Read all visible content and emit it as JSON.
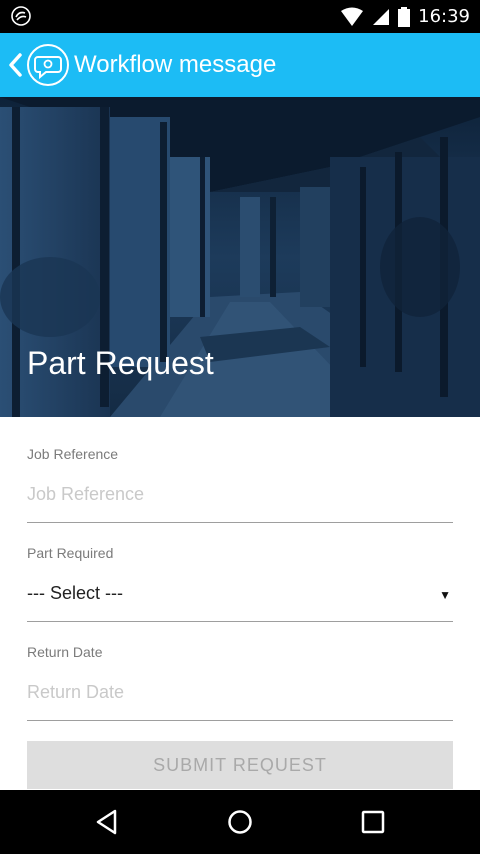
{
  "status_bar": {
    "time": "16:39"
  },
  "app_bar": {
    "title": "Workflow message"
  },
  "hero": {
    "title": "Part Request"
  },
  "form": {
    "job_reference": {
      "label": "Job Reference",
      "placeholder": "Job Reference"
    },
    "part_required": {
      "label": "Part Required",
      "value": "--- Select ---"
    },
    "return_date": {
      "label": "Return Date",
      "placeholder": "Return Date"
    }
  },
  "submit": {
    "label": "SUBMIT REQUEST"
  },
  "colors": {
    "app_bar": "#1cbcf5",
    "hero_tint": "#142c47",
    "submit_disabled": "#dedede"
  },
  "icons": [
    "notification-app-icon",
    "wifi-icon",
    "signal-icon",
    "battery-icon",
    "back-arrow-icon",
    "chat-logo-icon",
    "nav-back-icon",
    "nav-home-icon",
    "nav-recents-icon"
  ]
}
